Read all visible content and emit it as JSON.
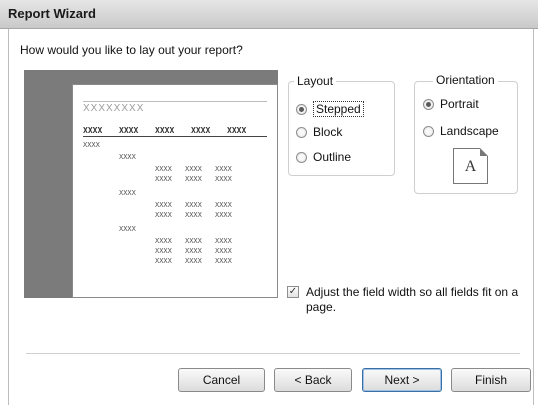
{
  "window": {
    "title": "Report Wizard"
  },
  "question": "How would you like to lay out your report?",
  "preview": {
    "title_placeholder": "XXXXXXXX",
    "header_cells": [
      "XXXX",
      "XXXX",
      "XXXX",
      "XXXX",
      "XXXX"
    ],
    "cell": "XXXX"
  },
  "layout": {
    "legend": "Layout",
    "options": [
      {
        "label": "Stepped",
        "selected": true
      },
      {
        "label": "Block",
        "selected": false
      },
      {
        "label": "Outline",
        "selected": false
      }
    ]
  },
  "orientation": {
    "legend": "Orientation",
    "options": [
      {
        "label": "Portrait",
        "selected": true
      },
      {
        "label": "Landscape",
        "selected": false
      }
    ],
    "icon_letter": "A"
  },
  "adjust_width": {
    "label": "Adjust the field width so all fields fit on a page.",
    "checked": true
  },
  "buttons": {
    "cancel": "Cancel",
    "back": "< Back",
    "next": "Next >",
    "finish": "Finish"
  }
}
